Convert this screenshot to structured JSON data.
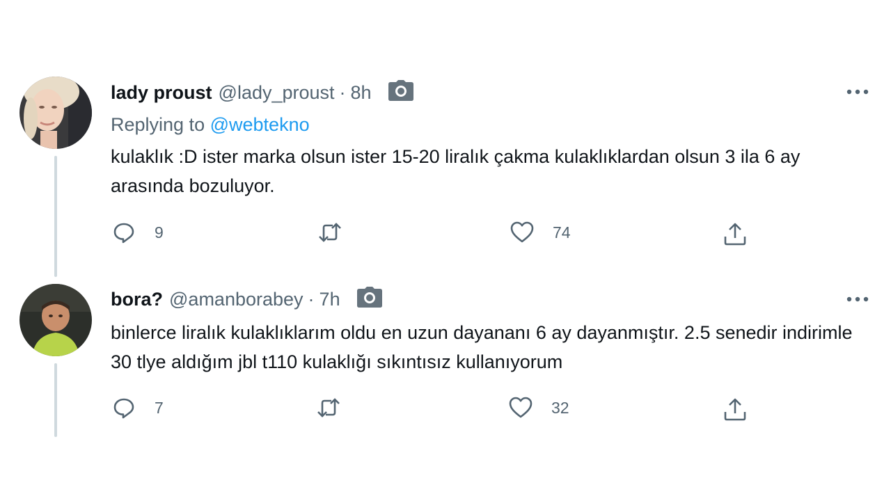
{
  "tweets": [
    {
      "name": "lady proust",
      "handle": "@lady_proust",
      "separator": "·",
      "time": "8h",
      "reply_prefix": "Replying to",
      "reply_to": "@webtekno",
      "text": "kulaklık :D ister marka olsun ister 15-20 liralık çakma kulaklıklardan olsun 3 ila 6 ay arasında bozuluyor.",
      "replies": "9",
      "retweets": "",
      "likes": "74"
    },
    {
      "name": "bora?",
      "handle": "@amanborabey",
      "separator": "·",
      "time": "7h",
      "text": "binlerce liralık kulaklıklarım oldu en uzun dayananı 6 ay dayanmıştır. 2.5 senedir indirimle 30 tlye aldığım jbl t110 kulaklığı sıkıntısız kullanıyorum",
      "replies": "7",
      "retweets": "",
      "likes": "32"
    }
  ],
  "icons": {
    "reply": "reply-icon",
    "retweet": "retweet-icon",
    "like": "heart-icon",
    "share": "share-icon",
    "media": "camera-icon",
    "more": "more-icon"
  },
  "colors": {
    "text": "#0f1419",
    "secondary": "#536471",
    "link": "#1d9bf0",
    "thread_line": "#cfd9de"
  }
}
